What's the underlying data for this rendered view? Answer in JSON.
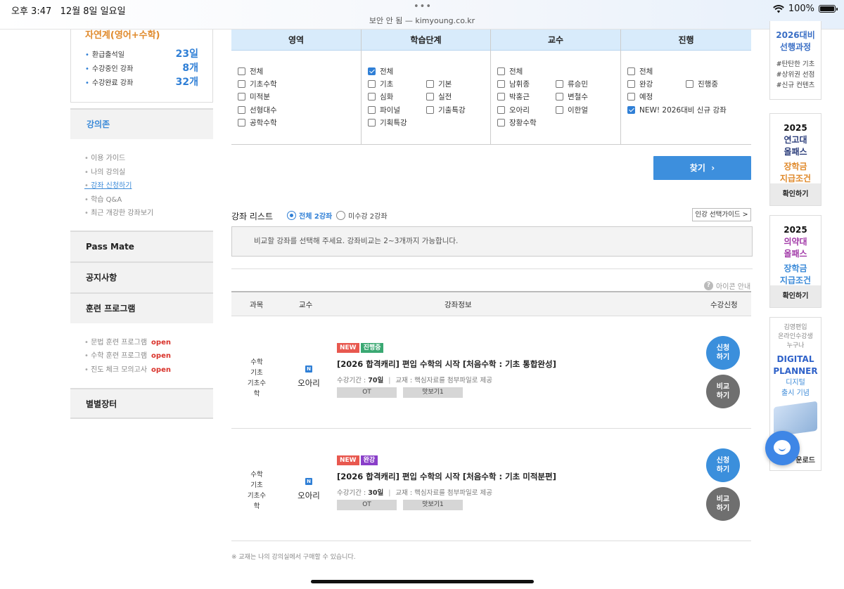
{
  "status_bar": {
    "time": "오후 3:47",
    "date": "12월 8일 일요일",
    "url": "보안 안 됨 — kimyoung.co.kr",
    "battery": "100%"
  },
  "sidebar": {
    "stats_title": "자연계(영어+수학)",
    "stats": [
      {
        "label": "환급출석일",
        "value": "23일"
      },
      {
        "label": "수강중인 강좌",
        "value": "8개"
      },
      {
        "label": "수강완료 강좌",
        "value": "32개"
      }
    ],
    "lecture_head": "강의존",
    "lecture_links": [
      "이용 가이드",
      "나의 강의실",
      "강좌 신청하기",
      "학습 Q&A",
      "최근 개강한 강좌보기"
    ],
    "pass_mate": "Pass Mate",
    "notice": "공지사항",
    "training": "훈련 프로그램",
    "training_links": [
      {
        "label": "문법 훈련 프로그램",
        "tag": "open"
      },
      {
        "label": "수학 훈련 프로그램",
        "tag": "open"
      },
      {
        "label": "진도 체크 모의고사",
        "tag": "open"
      }
    ],
    "market": "별별장터"
  },
  "filters": {
    "cols": [
      {
        "head": "영역",
        "options": [
          "전체",
          "기초수학",
          "미적분",
          "선형대수",
          "공학수학"
        ]
      },
      {
        "head": "학습단계",
        "options": [
          "전체",
          "기초",
          "심화",
          "파이널",
          "기획특강",
          "기본",
          "실전",
          "기출특강"
        ]
      },
      {
        "head": "교수",
        "options": [
          "전체",
          "남휘종",
          "박홍근",
          "오아리",
          "장황수학",
          "류승민",
          "변철수",
          "이한얼"
        ]
      },
      {
        "head": "진행",
        "options": [
          "전체",
          "완강",
          "예정",
          "NEW! 2026대비 신규 강좌",
          "진행중"
        ]
      }
    ],
    "search_label": "찾기"
  },
  "list": {
    "label": "강좌 리스트",
    "radio_all": "전체 2강좌",
    "radio_not": "미수강 2강좌",
    "guide": "인강 선택가이드 >",
    "compare_msg": "비교할 강좌를 선택해 주세요. 강좌비교는 2~3개까지 가능합니다.",
    "icon_guide": "아이콘 안내",
    "headers": [
      "과목",
      "교수",
      "강좌정보",
      "수강신청"
    ]
  },
  "rows": [
    {
      "subject": [
        "수학",
        "기초",
        "기초수학"
      ],
      "prof_badge": "N",
      "prof": "오아리",
      "badge_new": "NEW",
      "badge_status": "진행중",
      "title": "[2026 합격캐리] 편입 수학의 시작 [처음수학 : 기초 통합완성]",
      "period_label": "수강기간 :",
      "period": "70일",
      "book": "교재 : 핵심자료를 첨부파일로 제공",
      "btn_ot": "OT",
      "btn_preview": "맛보기1",
      "apply": [
        "신청",
        "하기"
      ],
      "compare": [
        "비교",
        "하기"
      ]
    },
    {
      "subject": [
        "수학",
        "기초",
        "기초수학"
      ],
      "prof_badge": "N",
      "prof": "오아리",
      "badge_new": "NEW",
      "badge_status": "완강",
      "title": "[2026 합격캐리] 편입 수학의 시작 [처음수학 : 기초 미적분편]",
      "period_label": "수강기간 :",
      "period": "30일",
      "book": "교재 : 핵심자료를 첨부파일로 제공",
      "btn_ot": "OT",
      "btn_preview": "맛보기1",
      "apply": [
        "신청",
        "하기"
      ],
      "compare": [
        "비교",
        "하기"
      ]
    }
  ],
  "footnote": "※ 교재는 나의 강의실에서 구매할 수 있습니다.",
  "banners": {
    "b1": [
      "2026대비",
      "선행과정",
      "#탄탄한 기초",
      "#상위권 선점",
      "#신규 컨텐츠"
    ],
    "b2": [
      "2025",
      "연고대",
      "올패스",
      "장학금",
      "지급조건",
      "확인하기"
    ],
    "b3": [
      "2025",
      "의약대",
      "올패스",
      "장학금",
      "지급조건",
      "확인하기"
    ],
    "b4": [
      "김영편입",
      "온라인수강생",
      "누구나",
      "DIGITAL",
      "PLANNER",
      "디지털",
      "출시 기념",
      "운로드"
    ]
  },
  "colors": {
    "accent": "#3d8fdd",
    "new_badge": "#e8584f",
    "progress_badge": "#3aa872",
    "done_badge": "#8a3fc9",
    "orange": "#e08a2c"
  }
}
